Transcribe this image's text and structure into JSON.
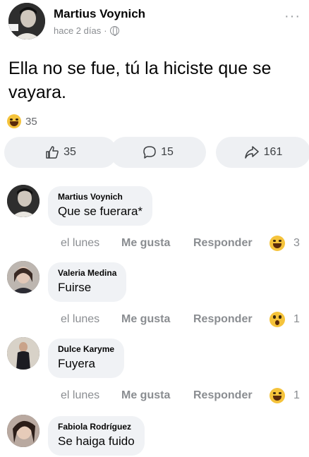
{
  "post": {
    "author": "Martius Voynich",
    "time": "hace 2 días",
    "separator": "·",
    "text": "Ella no se fue, tú la hiciste que se vayara.",
    "reaction_count": "35",
    "more_glyph": "···"
  },
  "actions": {
    "like_count": "35",
    "comment_count": "15",
    "share_count": "161"
  },
  "comments": [
    {
      "author": "Martius Voynich",
      "text": "Que se fuerara*",
      "time": "el lunes",
      "like": "Me gusta",
      "reply": "Responder",
      "reaction": "haha",
      "reaction_count": "3"
    },
    {
      "author": "Valeria Medina",
      "text": "Fuirse",
      "time": "el lunes",
      "like": "Me gusta",
      "reply": "Responder",
      "reaction": "wow",
      "reaction_count": "1"
    },
    {
      "author": "Dulce Karyme",
      "text": "Fuyera",
      "time": "el lunes",
      "like": "Me gusta",
      "reply": "Responder",
      "reaction": "haha",
      "reaction_count": "1"
    },
    {
      "author": "Fabiola Rodríguez",
      "text": "Se haiga fuido"
    }
  ],
  "colors": {
    "background": "#ffffff",
    "bubble": "#f0f2f5",
    "action_button": "#eef0f3",
    "muted_text": "#8a8d91",
    "emoji_yellow": "#f5c33b"
  }
}
